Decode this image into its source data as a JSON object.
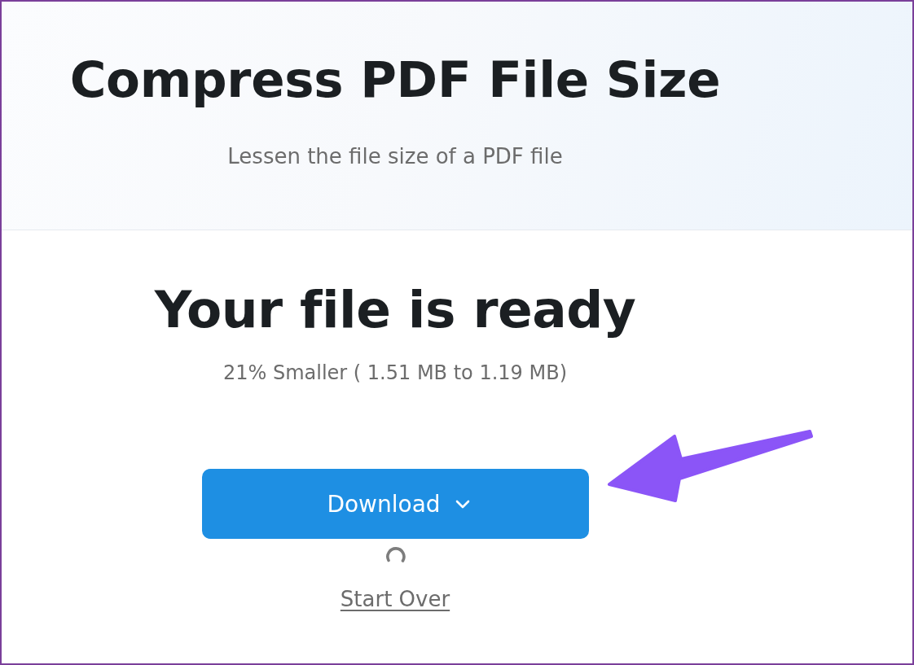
{
  "header": {
    "title": "Compress PDF File Size",
    "subtitle": "Lessen the file size of a PDF file"
  },
  "result": {
    "heading": "Your file is ready",
    "summary": "21% Smaller ( 1.51 MB to 1.19 MB)"
  },
  "download_button": {
    "label": "Download"
  },
  "start_over_link": {
    "label": "Start Over"
  }
}
